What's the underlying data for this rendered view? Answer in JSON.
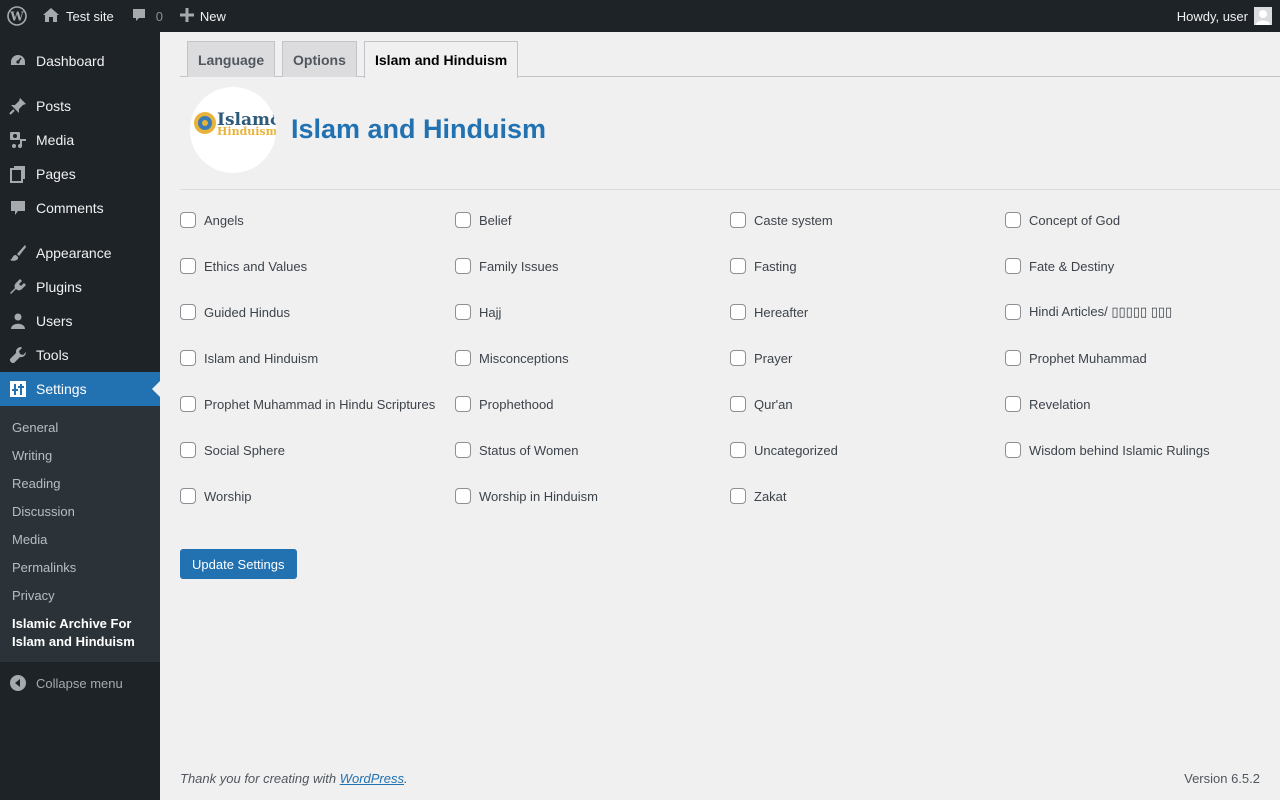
{
  "adminbar": {
    "site_name": "Test site",
    "comments_count": "0",
    "new_label": "New",
    "howdy": "Howdy, user"
  },
  "sidebar": {
    "items": [
      {
        "label": "Dashboard",
        "icon": "dashboard-icon"
      },
      {
        "label": "Posts",
        "icon": "pin-icon"
      },
      {
        "label": "Media",
        "icon": "media-icon"
      },
      {
        "label": "Pages",
        "icon": "pages-icon"
      },
      {
        "label": "Comments",
        "icon": "comment-icon"
      },
      {
        "label": "Appearance",
        "icon": "brush-icon"
      },
      {
        "label": "Plugins",
        "icon": "plug-icon"
      },
      {
        "label": "Users",
        "icon": "user-icon"
      },
      {
        "label": "Tools",
        "icon": "wrench-icon"
      },
      {
        "label": "Settings",
        "icon": "settings-icon"
      }
    ],
    "submenu": [
      "General",
      "Writing",
      "Reading",
      "Discussion",
      "Media",
      "Permalinks",
      "Privacy",
      "Islamic Archive For Islam and Hinduism"
    ],
    "collapse_label": "Collapse menu"
  },
  "tabs": [
    "Language",
    "Options",
    "Islam and Hinduism"
  ],
  "brand": {
    "title": "Islam and Hinduism",
    "logo_text_1": "Islam&",
    "logo_text_2": "Hinduism"
  },
  "categories": [
    "Angels",
    "Belief",
    "Caste system",
    "Concept of God",
    "Ethics and Values",
    "Family Issues",
    "Fasting",
    "Fate & Destiny",
    "Guided Hindus",
    "Hajj",
    "Hereafter",
    "Hindi Articles/ ▯▯▯▯▯ ▯▯▯",
    "Islam and Hinduism",
    "Misconceptions",
    "Prayer",
    "Prophet Muhammad",
    "Prophet Muhammad in Hindu Scriptures",
    "Prophethood",
    "Qur'an",
    "Revelation",
    "Social Sphere",
    "Status of Women",
    "Uncategorized",
    "Wisdom behind Islamic Rulings",
    "Worship",
    "Worship in Hinduism",
    "Zakat"
  ],
  "update_button": "Update Settings",
  "footer": {
    "thanks_prefix": "Thank you for creating with ",
    "wordpress_link": "WordPress",
    "thanks_suffix": ".",
    "version": "Version 6.5.2"
  },
  "colors": {
    "accent": "#2271b1",
    "adminbar_bg": "#1d2327",
    "submenu_bg": "#2c3338",
    "content_bg": "#f0f0f1"
  }
}
